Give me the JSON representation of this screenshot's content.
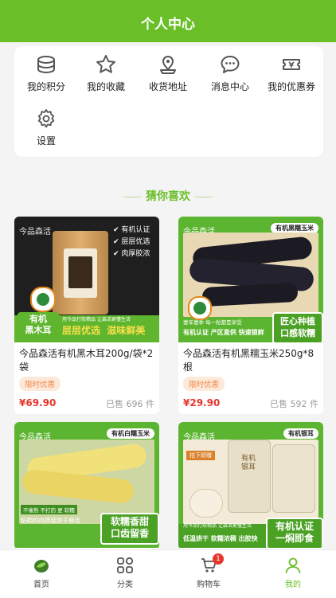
{
  "header": {
    "title": "个人中心"
  },
  "menu": [
    {
      "label": "我的积分",
      "icon": "coins-icon"
    },
    {
      "label": "我的收藏",
      "icon": "star-icon"
    },
    {
      "label": "收货地址",
      "icon": "map-pin-icon"
    },
    {
      "label": "消息中心",
      "icon": "chat-bubble-icon"
    },
    {
      "label": "我的优惠券",
      "icon": "coupon-icon"
    },
    {
      "label": "设置",
      "icon": "gear-icon"
    }
  ],
  "section": {
    "title": "猜你喜欢"
  },
  "products": [
    {
      "name": "今品森活有机黑木耳200g/袋*2袋",
      "tag": "限时优惠",
      "price": "¥69.90",
      "sold": "已售 696 件",
      "image": {
        "brand": "今品森活",
        "features": [
          "有机认证",
          "层层优选",
          "肉厚胶浓"
        ],
        "badge_left": "有机\n黑木耳",
        "slogan": "层层优选  滋味鲜美",
        "subline": "用今品打败精品  让森活更懂生活"
      }
    },
    {
      "name": "今品森活有机黑糯玉米250g*8根",
      "tag": "限时优惠",
      "price": "¥29.90",
      "sold": "已售 592 件",
      "image": {
        "brand": "今品森活",
        "label": "有机黑糯玉米",
        "badge": "匠心种植\n口感软糯",
        "slogan": "有机认证 产区直供 快速锁鲜",
        "subline": "壹年壹季 每一粒都是享受"
      }
    },
    {
      "name": "",
      "tag": "",
      "price": "",
      "sold": "",
      "image": {
        "brand": "今品森活",
        "label": "有机白糯玉米",
        "badge": "软糯香甜\n口齿留香",
        "subline": "不催熟 不打药 更 软糯",
        "subline2": "粘稠的肉质绽放于唇齿"
      }
    },
    {
      "name": "",
      "tag": "",
      "price": "",
      "sold": "",
      "image": {
        "brand": "今品森活",
        "label": "有机银耳",
        "tag2": "拍下即赠",
        "jar_text": "有机银耳",
        "badge": "有机认证\n一焖即食",
        "slogan": "低温烘干 软糯浓稠 出胶快",
        "subline": "用今品打败精品  让森活更懂生活"
      }
    }
  ],
  "tabbar": {
    "items": [
      {
        "label": "首页",
        "icon": "home-leaf-icon"
      },
      {
        "label": "分类",
        "icon": "category-grid-icon"
      },
      {
        "label": "购物车",
        "icon": "cart-icon",
        "badge": "1"
      },
      {
        "label": "我的",
        "icon": "user-icon",
        "active": true
      }
    ]
  },
  "colors": {
    "brand_green": "#6abf28",
    "price_red": "#e8352c",
    "tag_orange": "#f08a4b"
  }
}
